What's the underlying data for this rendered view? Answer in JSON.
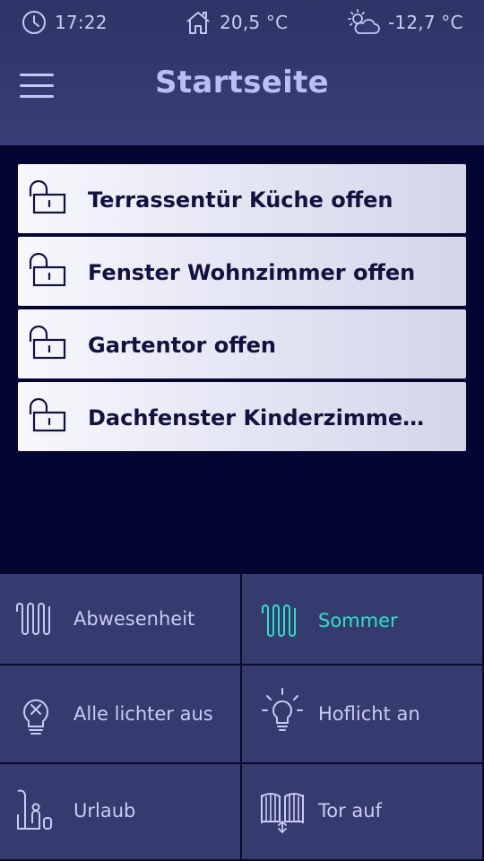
{
  "status": {
    "time": "17:22",
    "indoor_temp": "20,5 °C",
    "outdoor_temp": "-12,7 °C"
  },
  "header": {
    "title": "Startseite"
  },
  "alerts": [
    {
      "icon": "unlocked-padlock-icon",
      "text": "Terrassentür Küche offen"
    },
    {
      "icon": "unlocked-padlock-icon",
      "text": "Fenster Wohnzimmer offen"
    },
    {
      "icon": "unlocked-padlock-icon",
      "text": "Gartentor offen"
    },
    {
      "icon": "unlocked-padlock-icon",
      "text": "Dachfenster Kinderzimmer ob…"
    }
  ],
  "scenes": [
    {
      "icon": "radiator-icon",
      "label": "Abwesenheit",
      "active": false
    },
    {
      "icon": "radiator-icon",
      "label": "Sommer",
      "active": true
    },
    {
      "icon": "light-bulb-off-icon",
      "label": "Alle lichter aus",
      "active": false
    },
    {
      "icon": "light-bulb-on-icon",
      "label": "Hoflicht an",
      "active": false
    },
    {
      "icon": "vacation-icon",
      "label": "Urlaub",
      "active": false
    },
    {
      "icon": "gate-open-icon",
      "label": "Tor auf",
      "active": false
    }
  ],
  "colors": {
    "background": "#050532",
    "header": "#353b6e",
    "tile": "#353b6e",
    "active_accent": "#2ee0c8",
    "text_light": "#c8ccf4",
    "alert_text": "#11123e"
  }
}
